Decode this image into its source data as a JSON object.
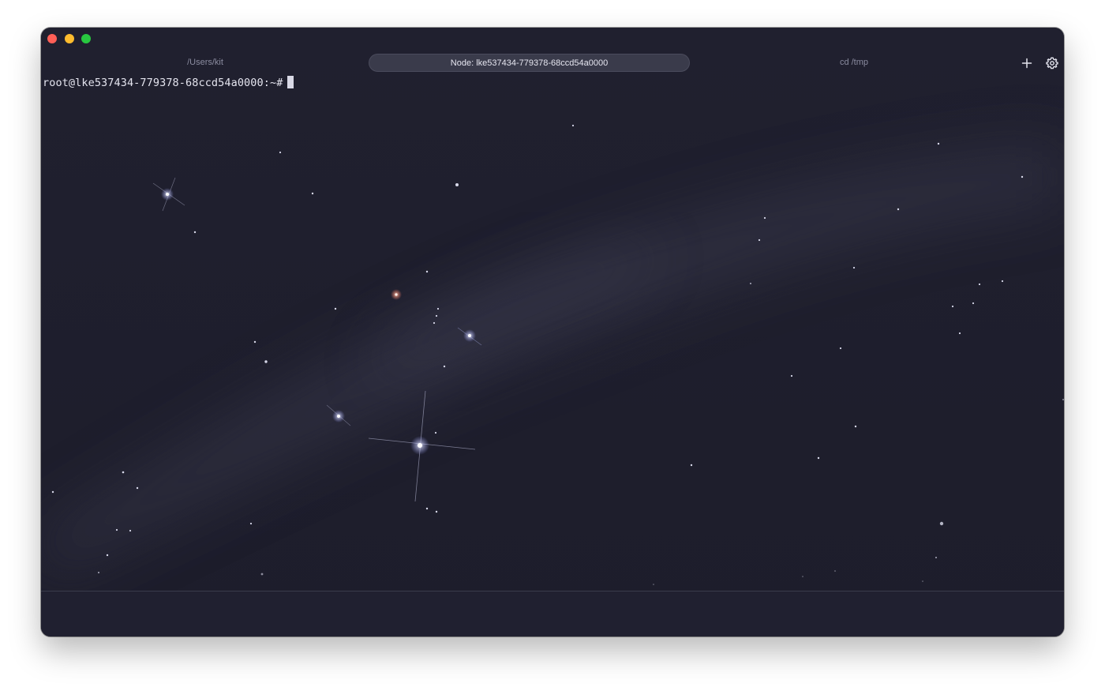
{
  "window": {
    "tabs": [
      {
        "label": "/Users/kit",
        "active": false
      },
      {
        "label": "Node: lke537434-779378-68ccd54a0000",
        "active": true
      },
      {
        "label": "cd /tmp",
        "active": false
      }
    ],
    "icons": {
      "new_tab": "plus-icon",
      "settings": "gear-icon"
    }
  },
  "terminal": {
    "prompt": "root@lke537434-779378-68ccd54a0000:~#"
  },
  "colors": {
    "background": "#1f1f2e",
    "active_tab": "#3a3b4b",
    "traffic_close": "#ff5f57",
    "traffic_minimize": "#febc2e",
    "traffic_maximize": "#28c840"
  }
}
